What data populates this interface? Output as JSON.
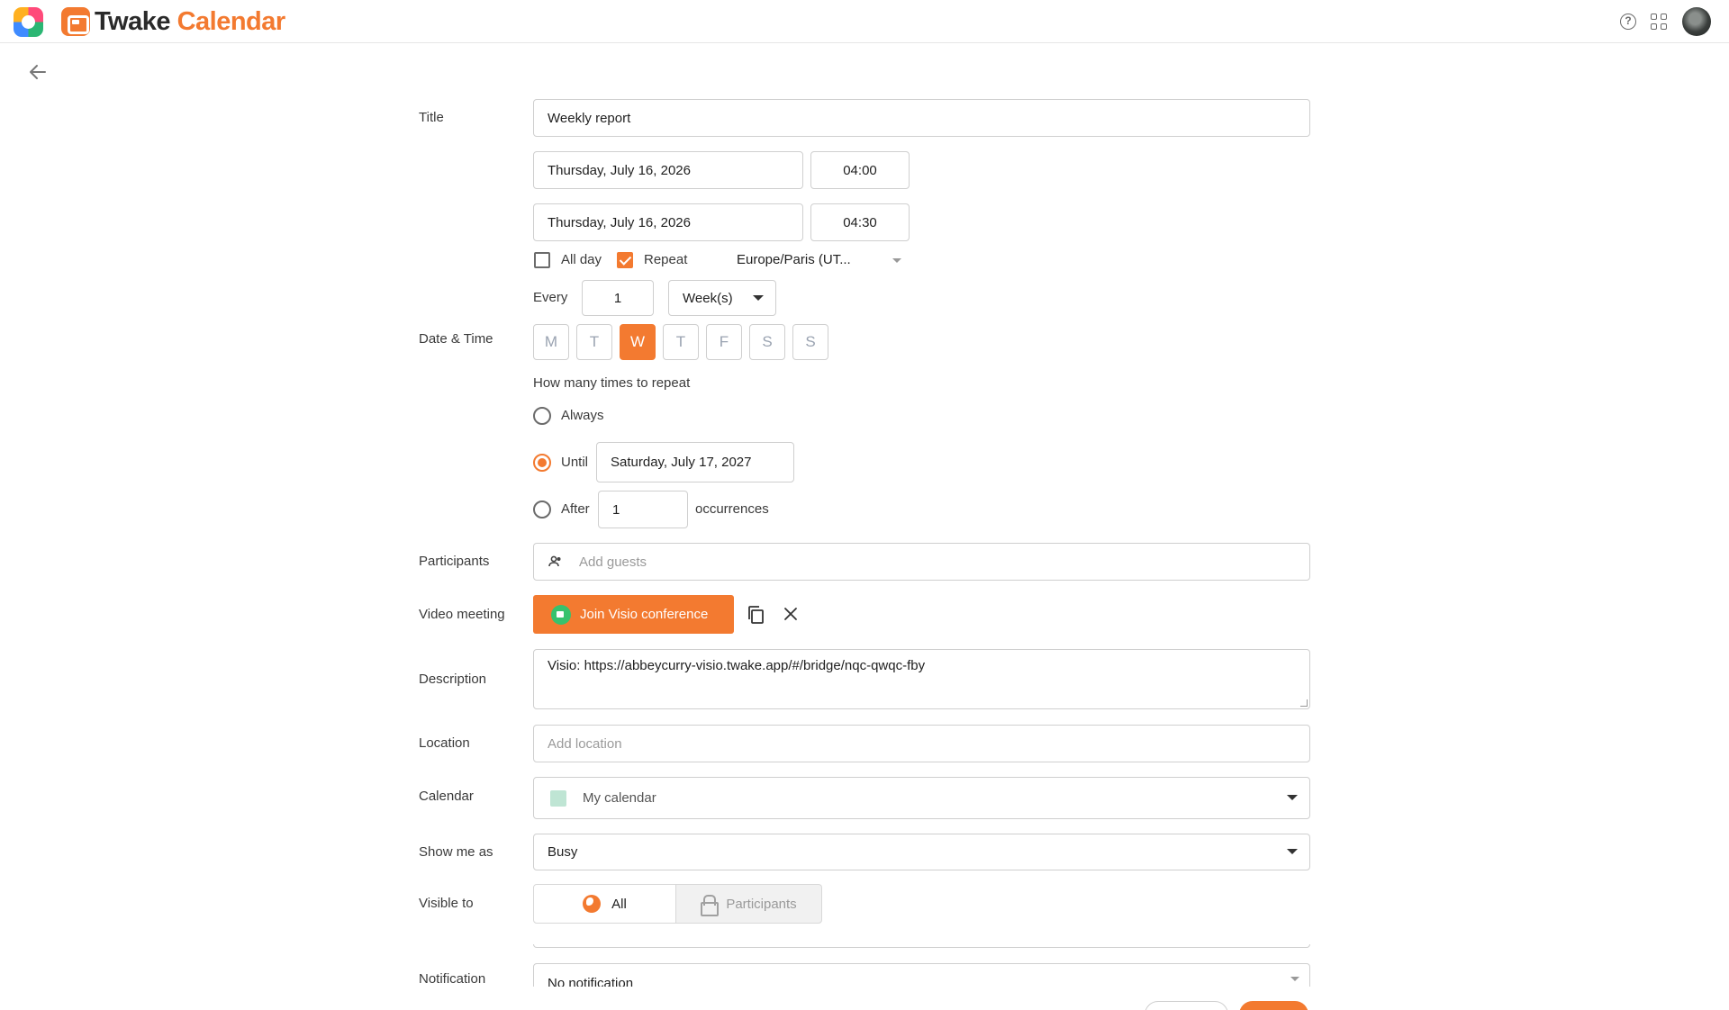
{
  "header": {
    "brand_part1": "Twake",
    "brand_part2": "Calendar",
    "help_label": "?"
  },
  "labels": {
    "title": "Title",
    "date_time": "Date & Time",
    "participants": "Participants",
    "video_meeting": "Video meeting",
    "description": "Description",
    "location": "Location",
    "calendar": "Calendar",
    "show_me_as": "Show me as",
    "visible_to": "Visible to",
    "notification": "Notification"
  },
  "event": {
    "title": "Weekly report",
    "start_date": "Thursday, July 16, 2026",
    "start_time": "04:00",
    "end_date": "Thursday, July 16, 2026",
    "end_time": "04:30",
    "all_day_label": "All day",
    "all_day_checked": false,
    "repeat_label": "Repeat",
    "repeat_checked": true,
    "timezone": "Europe/Paris (UT..."
  },
  "recurrence": {
    "every_label": "Every",
    "interval": "1",
    "unit": "Week(s)",
    "days": [
      {
        "label": "M",
        "selected": false
      },
      {
        "label": "T",
        "selected": false
      },
      {
        "label": "W",
        "selected": true
      },
      {
        "label": "T",
        "selected": false
      },
      {
        "label": "F",
        "selected": false
      },
      {
        "label": "S",
        "selected": false
      },
      {
        "label": "S",
        "selected": false
      }
    ],
    "how_many_label": "How many times to repeat",
    "always_label": "Always",
    "until_label": "Until",
    "until_date": "Saturday, July 17, 2027",
    "after_label": "After",
    "after_count": "1",
    "occurrences_label": "occurrences",
    "selected_end": "until"
  },
  "participants": {
    "placeholder": "Add guests"
  },
  "video": {
    "join_label": "Join Visio conference"
  },
  "description": {
    "value": "Visio: https://abbeycurry-visio.twake.app/#/bridge/nqc-qwqc-fby"
  },
  "location": {
    "placeholder": "Add location"
  },
  "calendar": {
    "value": "My calendar",
    "color": "#bfe5d4"
  },
  "show_me_as": {
    "value": "Busy"
  },
  "visibility": {
    "all_label": "All",
    "participants_label": "Participants",
    "selected": "All"
  },
  "notification": {
    "value": "No notification"
  },
  "colors": {
    "accent": "#f37a30",
    "visio_green": "#37c26d"
  }
}
